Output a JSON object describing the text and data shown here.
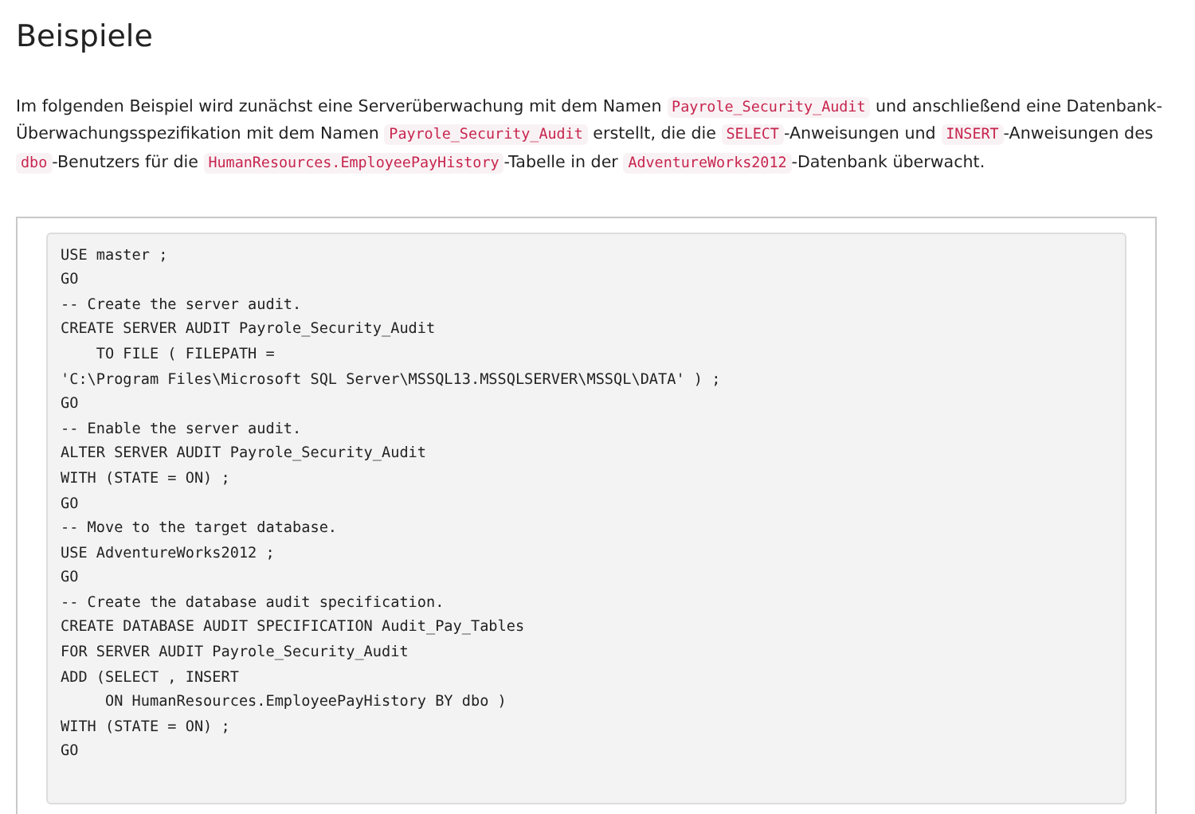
{
  "heading": "Beispiele",
  "paragraph": [
    {
      "kind": "text",
      "text": "Im folgenden Beispiel wird zunächst eine Serverüberwachung mit dem Namen "
    },
    {
      "kind": "code",
      "text": "Payrole_Security_Audit"
    },
    {
      "kind": "text",
      "text": " und anschließend eine Datenbank-Überwachungsspezifikation mit dem Namen "
    },
    {
      "kind": "code",
      "text": "Payrole_Security_Audit"
    },
    {
      "kind": "text",
      "text": " erstellt, die die "
    },
    {
      "kind": "code",
      "text": "SELECT"
    },
    {
      "kind": "text",
      "text": "-Anweisungen und "
    },
    {
      "kind": "code",
      "text": "INSERT"
    },
    {
      "kind": "text",
      "text": "-Anweisungen des "
    },
    {
      "kind": "code",
      "text": "dbo"
    },
    {
      "kind": "text",
      "text": "-Benutzers für die "
    },
    {
      "kind": "code",
      "text": "HumanResources.EmployeePayHistory"
    },
    {
      "kind": "text",
      "text": "-Tabelle in der "
    },
    {
      "kind": "code",
      "text": "AdventureWorks2012"
    },
    {
      "kind": "text",
      "text": "-Datenbank überwacht."
    }
  ],
  "code_lines": [
    "USE master ;",
    "GO",
    "-- Create the server audit.",
    "CREATE SERVER AUDIT Payrole_Security_Audit",
    "    TO FILE ( FILEPATH =",
    "'C:\\Program Files\\Microsoft SQL Server\\MSSQL13.MSSQLSERVER\\MSSQL\\DATA' ) ;",
    "GO",
    "-- Enable the server audit.",
    "ALTER SERVER AUDIT Payrole_Security_Audit",
    "WITH (STATE = ON) ;",
    "GO",
    "-- Move to the target database.",
    "USE AdventureWorks2012 ;",
    "GO",
    "-- Create the database audit specification.",
    "CREATE DATABASE AUDIT SPECIFICATION Audit_Pay_Tables",
    "FOR SERVER AUDIT Payrole_Security_Audit",
    "ADD (SELECT , INSERT",
    "     ON HumanResources.EmployeePayHistory BY dbo )",
    "WITH (STATE = ON) ;",
    "GO"
  ]
}
